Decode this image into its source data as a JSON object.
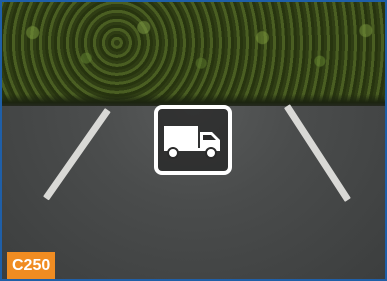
{
  "scene": {
    "description_icon": "truck-icon",
    "badge_code": "C250"
  },
  "colors": {
    "border": "#1f5fa8",
    "badge": "#f08c22",
    "tile_border": "#ffffff",
    "lines": "#d9d9d6"
  }
}
